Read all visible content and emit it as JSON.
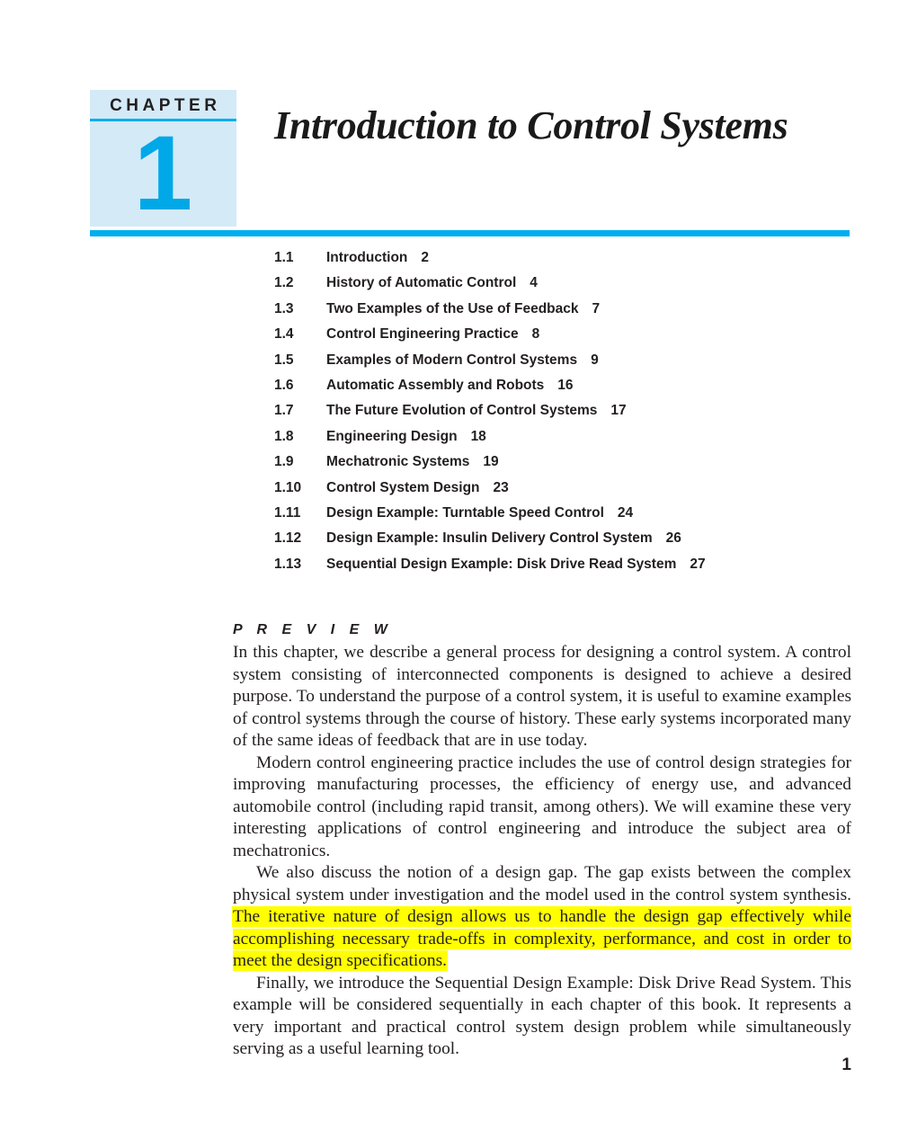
{
  "colors": {
    "accent_rule": "#00aeef",
    "badge_background": "#d4eaf7",
    "chapter_numeral": "#00a8e8",
    "highlight": "#ffff00",
    "text": "#231f20"
  },
  "chapter": {
    "label": "CHAPTER",
    "number": "1",
    "title": "Introduction to Control Systems"
  },
  "toc": {
    "entries": [
      {
        "number": "1.1",
        "title": "Introduction",
        "page": "2"
      },
      {
        "number": "1.2",
        "title": "History of Automatic Control",
        "page": "4"
      },
      {
        "number": "1.3",
        "title": "Two Examples of the Use of Feedback",
        "page": "7"
      },
      {
        "number": "1.4",
        "title": "Control Engineering Practice",
        "page": "8"
      },
      {
        "number": "1.5",
        "title": "Examples of Modern Control Systems",
        "page": "9"
      },
      {
        "number": "1.6",
        "title": "Automatic Assembly and Robots",
        "page": "16"
      },
      {
        "number": "1.7",
        "title": "The Future Evolution of Control Systems",
        "page": "17"
      },
      {
        "number": "1.8",
        "title": "Engineering Design",
        "page": "18"
      },
      {
        "number": "1.9",
        "title": "Mechatronic Systems",
        "page": "19"
      },
      {
        "number": "1.10",
        "title": "Control System Design",
        "page": "23"
      },
      {
        "number": "1.11",
        "title": "Design Example: Turntable Speed Control",
        "page": "24"
      },
      {
        "number": "1.12",
        "title": "Design Example: Insulin Delivery Control System",
        "page": "26"
      },
      {
        "number": "1.13",
        "title": "Sequential Design Example: Disk Drive Read System",
        "page": "27"
      }
    ]
  },
  "preview": {
    "heading": "P R E V I E W",
    "paragraph_1": "In this chapter, we describe a general process for designing a control system. A control system consisting of interconnected components is designed to achieve a desired purpose. To understand the purpose of a control system, it is useful to examine examples of control systems through the course of history. These early systems incorporated many of the same ideas of feedback that are in use today.",
    "paragraph_2": "Modern control engineering practice includes the use of control design strategies for improving manufacturing processes, the efficiency of energy use, and advanced automobile control (including rapid transit, among others). We will examine these very interesting applications of control engineering and introduce the subject area of mechatronics.",
    "paragraph_3_before_highlight": "We also discuss the notion of a design gap. The gap exists between the complex physical system under investigation and the model used in the control system synthesis. ",
    "paragraph_3_highlighted": "The iterative nature of design allows us to handle the design gap effectively while accomplishing necessary trade-offs in complexity, performance, and cost in order to meet the design specifications.",
    "paragraph_4": "Finally, we introduce the Sequential Design Example: Disk Drive Read System. This example will be considered sequentially in each chapter of this book. It represents a very important and practical control system design problem while simultaneously serving as a useful learning tool."
  },
  "folio": {
    "page_number": "1"
  }
}
